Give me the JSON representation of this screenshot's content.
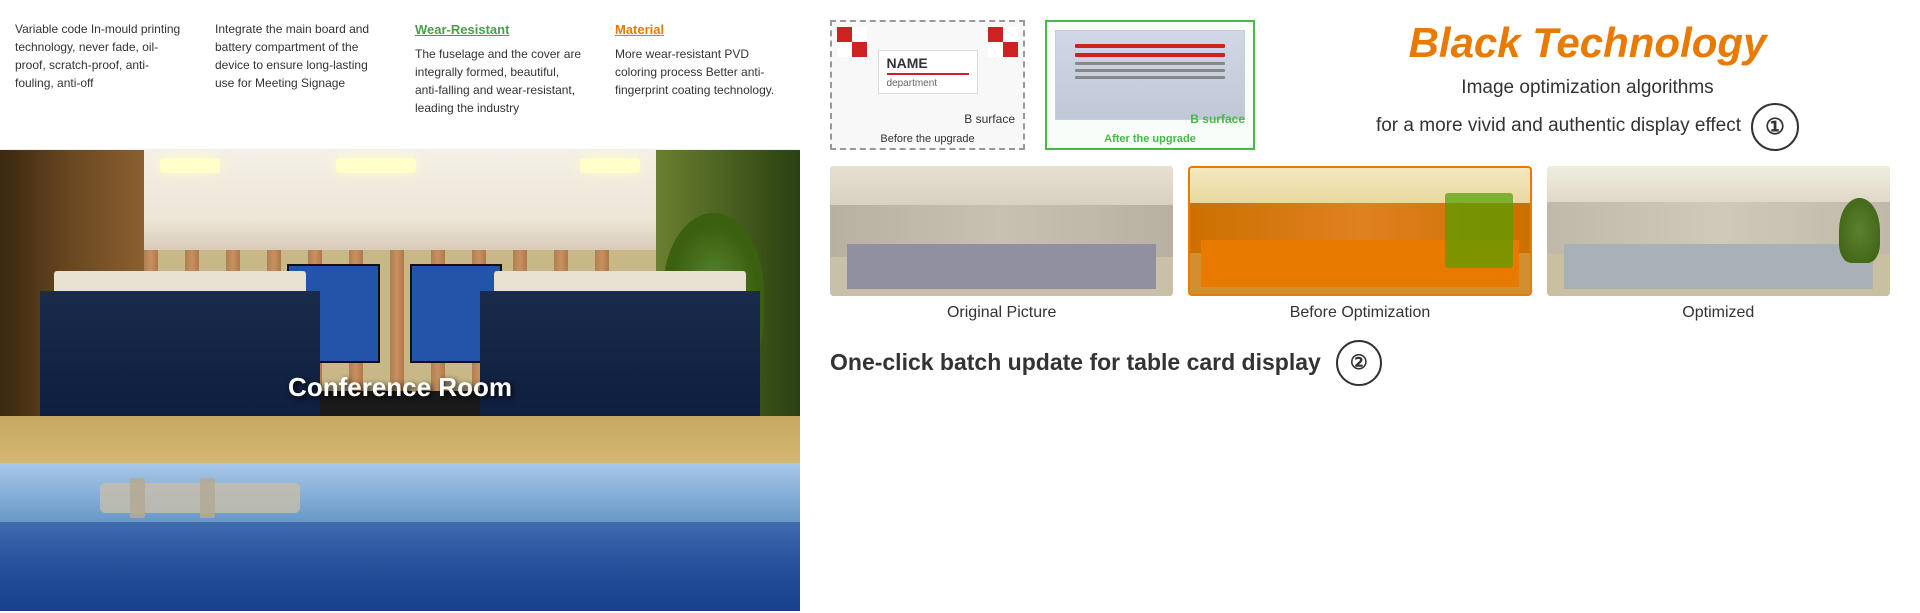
{
  "features": [
    {
      "id": "variable-code",
      "title": null,
      "text": "Variable code In-mould printing technology, never fade, oil-proof, scratch-proof, anti-fouling, anti-off"
    },
    {
      "id": "battery",
      "title": null,
      "text": "Integrate the main board and battery compartment of the device to ensure long-lasting use for Meeting Signage"
    },
    {
      "id": "wear-resistant",
      "title": "Wear-Resistant",
      "title_color": "#4a9e4a",
      "text": "The fuselage and the cover are integrally formed, beautiful, anti-falling and wear-resistant, leading the industry"
    },
    {
      "id": "material",
      "title": "Material",
      "title_color": "#e87a00",
      "text": "More wear-resistant PVD coloring process Better anti-fingerprint coating technology."
    }
  ],
  "conference_room": {
    "label": "Conference Room"
  },
  "upgrade_section": {
    "b_surface_before": "B surface",
    "before_the_upgrade": "Before the upgrade",
    "b_surface_after": "B surface",
    "after_the_upgrade": "After the upgrade",
    "name_badge": {
      "name": "NAME",
      "department": "department"
    }
  },
  "black_technology": {
    "title": "Black Technology",
    "subtitle_line1": "Image optimization algorithms",
    "subtitle_line2": "for a more vivid and authentic display effect"
  },
  "comparison": {
    "badge_1": "①",
    "items": [
      {
        "label": "Original Picture"
      },
      {
        "label": "Before Optimization"
      },
      {
        "label": "Optimized"
      }
    ]
  },
  "one_click": {
    "text": "One-click batch update for table card display",
    "badge": "②"
  }
}
